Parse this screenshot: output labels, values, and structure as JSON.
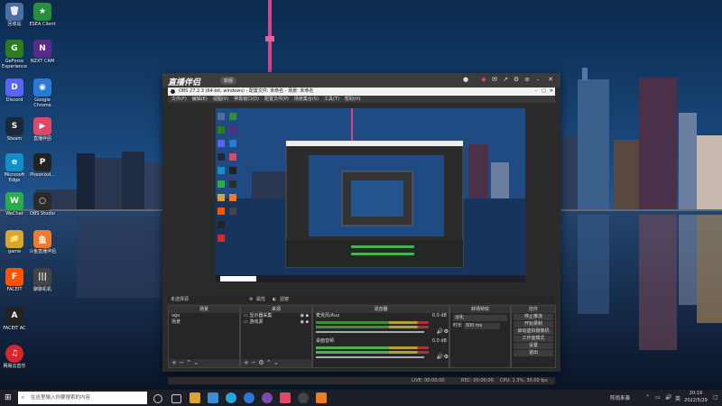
{
  "desktop": {
    "icons": [
      {
        "label": "回收站",
        "glyph": "🗑",
        "color": "#4a6fa5"
      },
      {
        "label": "ESEA Client",
        "glyph": "★",
        "color": "#2a8f3a"
      },
      {
        "label": "GeForce Experience",
        "glyph": "G",
        "color": "#2d7d1e"
      },
      {
        "label": "NZXT CAM",
        "glyph": "N",
        "color": "#5a2a8a"
      },
      {
        "label": "Discord",
        "glyph": "D",
        "color": "#5865f2"
      },
      {
        "label": "Google Chrome",
        "glyph": "◉",
        "color": "#2a79d8"
      },
      {
        "label": "Steam",
        "glyph": "S",
        "color": "#1b2838"
      },
      {
        "label": "直播伴侣",
        "glyph": "▶",
        "color": "#e04868"
      },
      {
        "label": "Microsoft Edge",
        "glyph": "e",
        "color": "#138fc7"
      },
      {
        "label": "Pheonixd...",
        "glyph": "P",
        "color": "#222"
      },
      {
        "label": "WeChat",
        "glyph": "W",
        "color": "#2aae4a"
      },
      {
        "label": "OBS Studio",
        "glyph": "○",
        "color": "#2b2b2b"
      },
      {
        "label": "game",
        "glyph": "📁",
        "color": "#d9a431"
      },
      {
        "label": "斗鱼直播伴侣",
        "glyph": "鱼",
        "color": "#f07a2a"
      },
      {
        "label": "FACEIT",
        "glyph": "F",
        "color": "#ff5500"
      },
      {
        "label": "聊聊机机",
        "glyph": "|||",
        "color": "#444"
      },
      {
        "label": "FACEIT AC",
        "glyph": "A",
        "color": "#222"
      },
      {
        "label": "网易云音乐",
        "glyph": "♫",
        "color": "#d9262e"
      }
    ]
  },
  "app": {
    "logo": "直播伴侣",
    "badge": "新版",
    "obs_title": "OBS 27.2.3 (64-bit, windows) - 配置文件: 未命名 - 场景: 未命名",
    "menu": [
      "文件(F)",
      "编辑(E)",
      "视图(V)",
      "停靠窗口(D)",
      "配置文件(P)",
      "场景集合(S)",
      "工具(T)",
      "帮助(H)"
    ],
    "scene_status": "未选择源",
    "prop_button": "属性",
    "filter_button": "滤镜",
    "panels": {
      "scenes": {
        "title": "场景",
        "items": [
          "ogo",
          "场景"
        ]
      },
      "sources": {
        "title": "来源",
        "items": [
          "显示器采集",
          "游戏源"
        ]
      },
      "mixer": {
        "title": "混音器",
        "channels": [
          {
            "name": "麦克风/Aux",
            "db": "0.0 dB"
          },
          {
            "name": "桌面音频",
            "db": "0.0 dB"
          }
        ]
      },
      "transitions": {
        "title": "转场特效",
        "type": "淡化",
        "duration_label": "时长",
        "duration": "300 ms"
      },
      "controls": {
        "title": "控件",
        "buttons": [
          "停止推流",
          "开始录制",
          "启动虚拟摄像机",
          "工作室模式",
          "设置",
          "退出"
        ]
      }
    },
    "status": {
      "live": "LIVE: 00:00:00",
      "rec": "REC: 00:00:00",
      "cpu": "CPU: 1.3%, 30.00 fps"
    }
  },
  "taskbar": {
    "search_placeholder": "在这里输入你要搜索的内容",
    "weather": "阵雨来袭",
    "time": "20:19",
    "date": "2022/5/29",
    "ime": "英"
  }
}
